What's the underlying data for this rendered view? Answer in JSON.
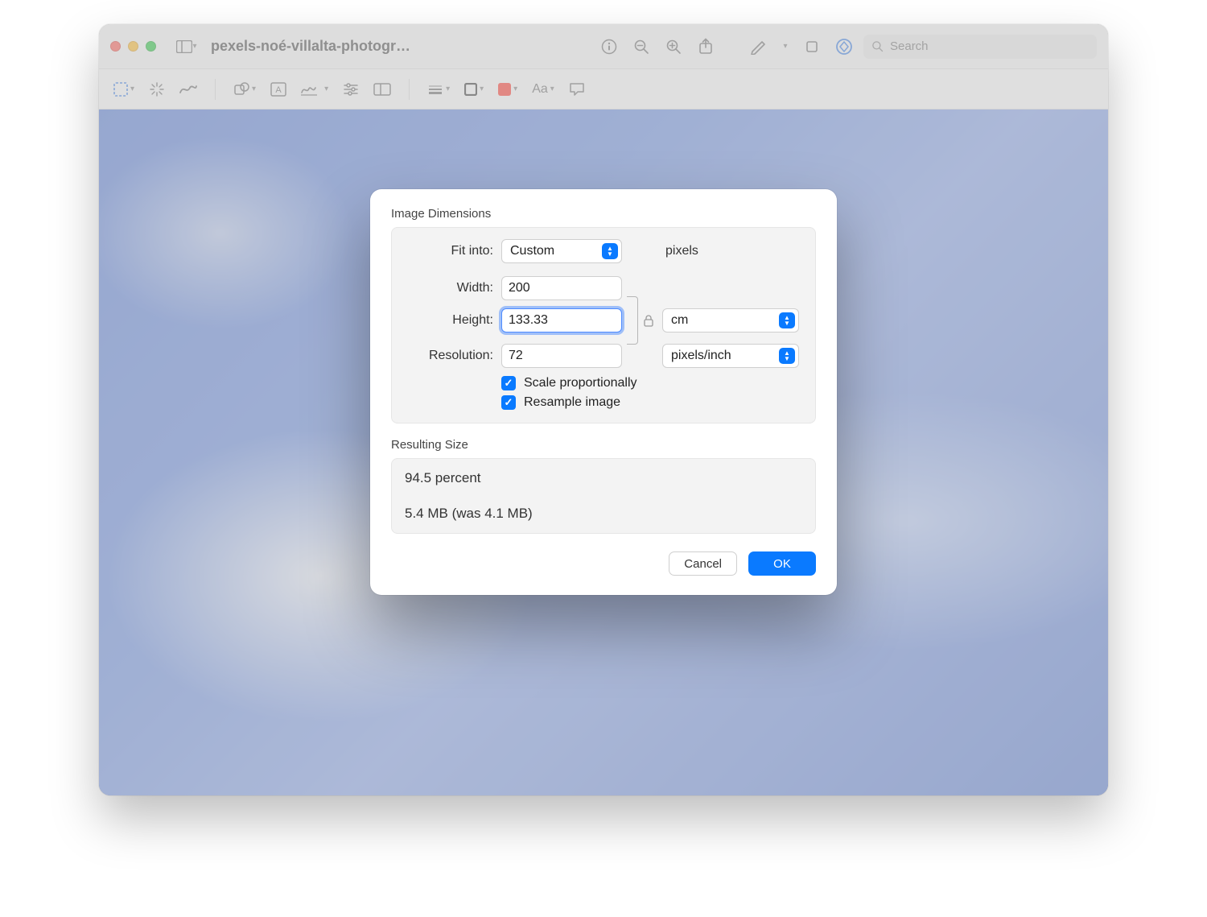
{
  "titlebar": {
    "filename": "pexels-noé-villalta-photogr…",
    "search_placeholder": "Search"
  },
  "dialog": {
    "section_dimensions": "Image Dimensions",
    "fit_into_label": "Fit into:",
    "fit_into_value": "Custom",
    "fit_into_unit": "pixels",
    "width_label": "Width:",
    "width_value": "200",
    "height_label": "Height:",
    "height_value": "133.33",
    "wh_unit_value": "cm",
    "resolution_label": "Resolution:",
    "resolution_value": "72",
    "resolution_unit_value": "pixels/inch",
    "scale_label": "Scale proportionally",
    "resample_label": "Resample image",
    "section_result": "Resulting Size",
    "result_percent": "94.5 percent",
    "result_size": "5.4 MB (was 4.1 MB)",
    "cancel": "Cancel",
    "ok": "OK"
  },
  "toolbar2": {
    "text_style": "Aa"
  }
}
